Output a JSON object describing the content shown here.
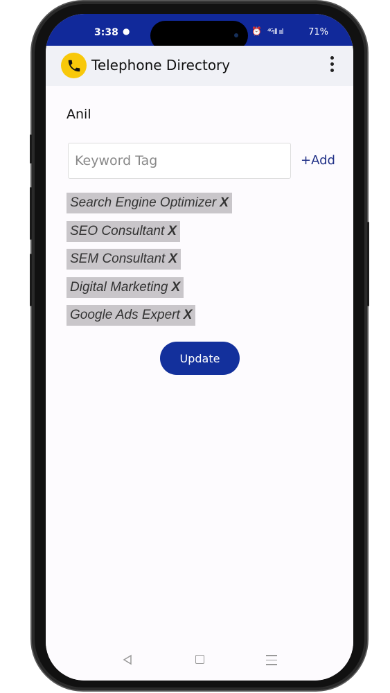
{
  "status_bar": {
    "time": "3:38",
    "signal_text": "⁴ᴳıll ııl",
    "battery": "71%",
    "icons": [
      "message-icon",
      "alarm-icon",
      "signal-icon",
      "battery-icon"
    ]
  },
  "app_bar": {
    "title": "Telephone Directory",
    "logo_icon": "phone-icon",
    "menu_icon": "more-vertical-icon",
    "colors": {
      "status_bar": "#11299a",
      "logo_bg": "#f8c80a"
    }
  },
  "form": {
    "contact_name": "Anil",
    "keyword_input": {
      "placeholder": "Keyword Tag",
      "value": ""
    },
    "add_label": "+Add",
    "tags": [
      {
        "label": "Search Engine Optimizer",
        "remove": "X"
      },
      {
        "label": "SEO Consultant",
        "remove": "X"
      },
      {
        "label": "SEM Consultant",
        "remove": "X"
      },
      {
        "label": "Digital Marketing",
        "remove": "X"
      },
      {
        "label": "Google Ads Expert",
        "remove": "X"
      }
    ],
    "update_label": "Update",
    "accent_color": "#13309c"
  },
  "nav_bar": {
    "back_icon": "back-triangle-icon",
    "home_icon": "home-square-icon",
    "recents_icon": "recents-lines-icon"
  }
}
